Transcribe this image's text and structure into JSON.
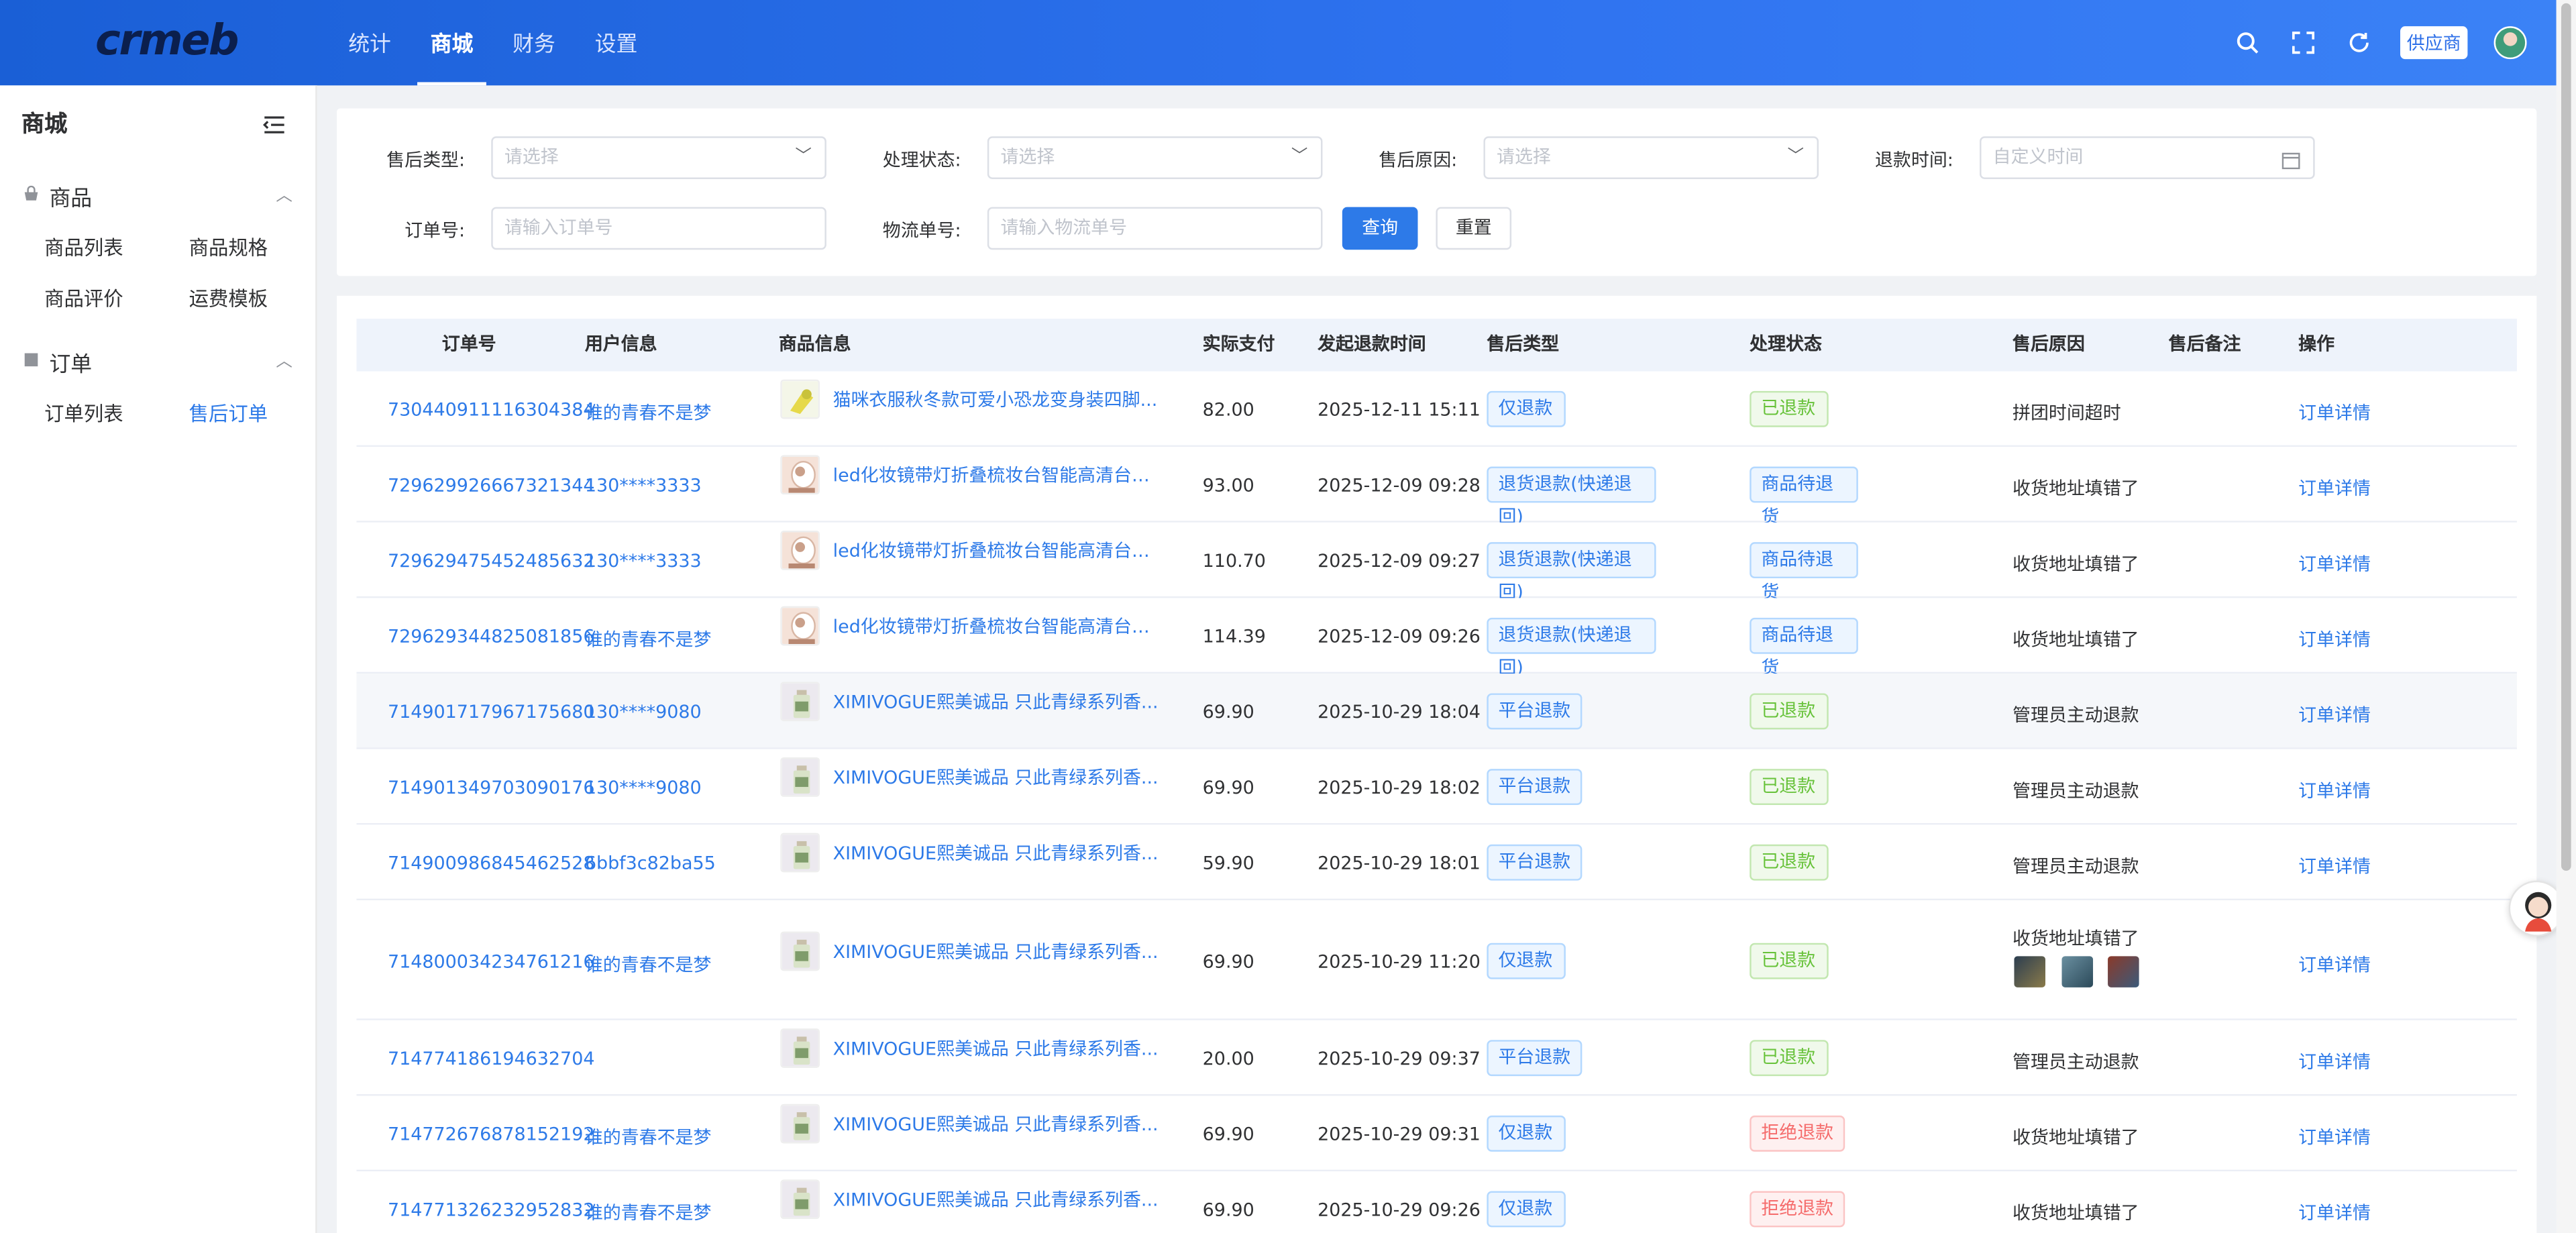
{
  "header": {
    "logo": "crmeb",
    "nav": [
      "统计",
      "商城",
      "财务",
      "设置"
    ],
    "active_nav": 1,
    "supplier_label": "供应商"
  },
  "sidebar": {
    "title": "商城",
    "groups": [
      {
        "label": "商品",
        "items": [
          "商品列表",
          "商品规格",
          "商品评价",
          "运费模板"
        ]
      },
      {
        "label": "订单",
        "items": [
          "订单列表",
          "售后订单"
        ]
      }
    ],
    "active_item": "售后订单"
  },
  "filters": {
    "type_label": "售后类型:",
    "type_placeholder": "请选择",
    "status_label": "处理状态:",
    "status_placeholder": "请选择",
    "reason_label": "售后原因:",
    "reason_placeholder": "请选择",
    "time_label": "退款时间:",
    "time_placeholder": "自定义时间",
    "order_label": "订单号:",
    "order_placeholder": "请输入订单号",
    "logistics_label": "物流单号:",
    "logistics_placeholder": "请输入物流单号",
    "query_btn": "查询",
    "reset_btn": "重置"
  },
  "table": {
    "headers": [
      "订单号",
      "用户信息",
      "商品信息",
      "实际支付",
      "发起退款时间",
      "售后类型",
      "处理状态",
      "售后原因",
      "售后备注",
      "操作"
    ],
    "rows": [
      {
        "order": "730440911116304384",
        "user": "谁的青春不是梦",
        "product": "猫咪衣服秋冬款可爱小恐龙变身装四脚...",
        "pay": "82.00",
        "time": "2025-12-11 15:11",
        "type": "仅退款",
        "status": "已退款",
        "status_color": "green",
        "reason": "拼团时间超时",
        "action": "订单详情",
        "thumb": "yellow"
      },
      {
        "order": "729629926667321344",
        "user": "130****3333",
        "product": "led化妆镜带灯折叠梳妆台智能高清台式...",
        "pay": "93.00",
        "time": "2025-12-09 09:28",
        "type": "退货退款(快递退回)",
        "status": "商品待退货",
        "status_color": "blue",
        "reason": "收货地址填错了",
        "action": "订单详情",
        "thumb": "mirror"
      },
      {
        "order": "729629475452485632",
        "user": "130****3333",
        "product": "led化妆镜带灯折叠梳妆台智能高清台式...",
        "pay": "110.70",
        "time": "2025-12-09 09:27",
        "type": "退货退款(快递退回)",
        "status": "商品待退货",
        "status_color": "blue",
        "reason": "收货地址填错了",
        "action": "订单详情",
        "thumb": "mirror"
      },
      {
        "order": "729629344825081856",
        "user": "谁的青春不是梦",
        "product": "led化妆镜带灯折叠梳妆台智能高清台式...",
        "pay": "114.39",
        "time": "2025-12-09 09:26",
        "type": "退货退款(快递退回)",
        "status": "商品待退货",
        "status_color": "blue",
        "reason": "收货地址填错了",
        "action": "订单详情",
        "thumb": "mirror"
      },
      {
        "order": "714901717967175680",
        "user": "130****9080",
        "product": "XIMIVOGUE熙美诚品 只此青绿系列香...",
        "pay": "69.90",
        "time": "2025-10-29 18:04",
        "type": "平台退款",
        "status": "已退款",
        "status_color": "green",
        "reason": "管理员主动退款",
        "action": "订单详情",
        "thumb": "bottle"
      },
      {
        "order": "714901349703090176",
        "user": "130****9080",
        "product": "XIMIVOGUE熙美诚品 只此青绿系列香...",
        "pay": "69.90",
        "time": "2025-10-29 18:02",
        "type": "平台退款",
        "status": "已退款",
        "status_color": "green",
        "reason": "管理员主动退款",
        "action": "订单详情",
        "thumb": "bottle"
      },
      {
        "order": "714900986845462528",
        "user": "6bbf3c82ba55",
        "product": "XIMIVOGUE熙美诚品 只此青绿系列香...",
        "pay": "59.90",
        "time": "2025-10-29 18:01",
        "type": "平台退款",
        "status": "已退款",
        "status_color": "green",
        "reason": "管理员主动退款",
        "action": "订单详情",
        "thumb": "bottle"
      },
      {
        "order": "714800034234761216",
        "user": "谁的青春不是梦",
        "product": "XIMIVOGUE熙美诚品 只此青绿系列香...",
        "pay": "69.90",
        "time": "2025-10-29 11:20",
        "type": "仅退款",
        "status": "已退款",
        "status_color": "green",
        "reason": "收货地址填错了",
        "action": "订单详情",
        "thumb": "bottle"
      },
      {
        "order": "714774186194632704",
        "user": "",
        "product": "XIMIVOGUE熙美诚品 只此青绿系列香...",
        "pay": "20.00",
        "time": "2025-10-29 09:37",
        "type": "平台退款",
        "status": "已退款",
        "status_color": "green",
        "reason": "管理员主动退款",
        "action": "订单详情",
        "thumb": "bottle"
      },
      {
        "order": "714772676878152192",
        "user": "谁的青春不是梦",
        "product": "XIMIVOGUE熙美诚品 只此青绿系列香...",
        "pay": "69.90",
        "time": "2025-10-29 09:31",
        "type": "仅退款",
        "status": "拒绝退款",
        "status_color": "red",
        "reason": "收货地址填错了",
        "action": "订单详情",
        "thumb": "bottle"
      },
      {
        "order": "714771326232952832",
        "user": "谁的青春不是梦",
        "product": "XIMIVOGUE熙美诚品 只此青绿系列香...",
        "pay": "69.90",
        "time": "2025-10-29 09:26",
        "type": "仅退款",
        "status": "拒绝退款",
        "status_color": "red",
        "reason": "收货地址填错了",
        "action": "订单详情",
        "thumb": "bottle"
      }
    ]
  }
}
